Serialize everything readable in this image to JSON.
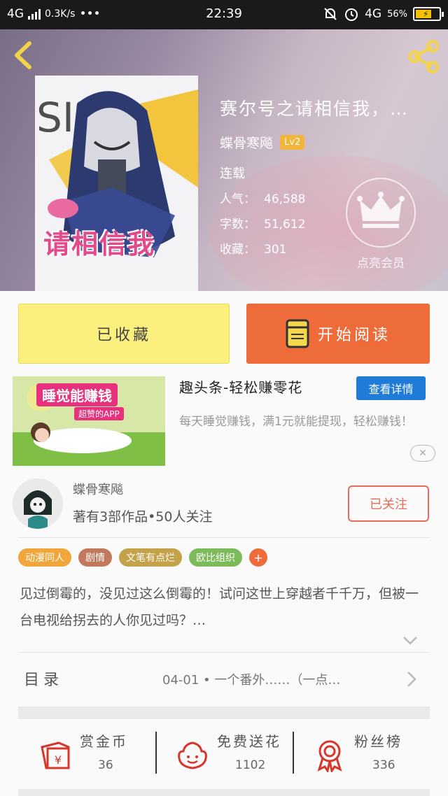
{
  "status_bar": {
    "network": "4G",
    "speed": "0.3K/s",
    "dots": "•••",
    "time": "22:39",
    "network_right": "4G",
    "battery": "56%"
  },
  "book": {
    "title": "赛尔号之请相信我，…",
    "author": "蝶骨寒飚",
    "level": "Lv2",
    "status": "连载",
    "popularity_label": "人气：",
    "popularity": "46,588",
    "words_label": "字数：",
    "words": "51,612",
    "collect_label": "收藏：",
    "collects": "301",
    "crown_label": "点亮会员"
  },
  "buttons": {
    "collected": "已收藏",
    "start_reading": "开始阅读"
  },
  "ad": {
    "image_text": "睡觉能赚钱",
    "image_sub": "超赞的APP",
    "title": "趣头条-轻松赚零花",
    "detail_button": "查看详情",
    "description": "每天睡觉赚钱，满1元就能提现，轻松赚钱！"
  },
  "author_row": {
    "name": "蝶骨寒飚",
    "meta": "著有3部作品•50人关注",
    "follow": "已关注"
  },
  "tags": [
    {
      "label": "动漫同人",
      "color": "#f0a63a"
    },
    {
      "label": "剧情",
      "color": "#c1785c"
    },
    {
      "label": "文笔有点烂",
      "color": "#c4a24a"
    },
    {
      "label": "欧比组织",
      "color": "#7dbb5a"
    },
    {
      "label": "+",
      "color": "#ee6b3a"
    }
  ],
  "synopsis": "见过倒霉的，没见过这么倒霉的！试问这世上穿越者千千万，但被一台电视给拐去的人你见过吗？…",
  "toc": {
    "label": "目录",
    "latest": "04-01 • 一个番外……（一点…"
  },
  "actions": [
    {
      "label": "赏金币",
      "value": "36",
      "icon": "reward-coin-icon"
    },
    {
      "label": "免费送花",
      "value": "1102",
      "icon": "flower-icon"
    },
    {
      "label": "粉丝榜",
      "value": "336",
      "icon": "fan-ranking-icon"
    }
  ],
  "colors": {
    "accent_orange": "#ee6b3a",
    "collected_yellow": "#fbf07d",
    "detail_blue": "#1e7bd8",
    "follow_red": "#e46d5b"
  }
}
